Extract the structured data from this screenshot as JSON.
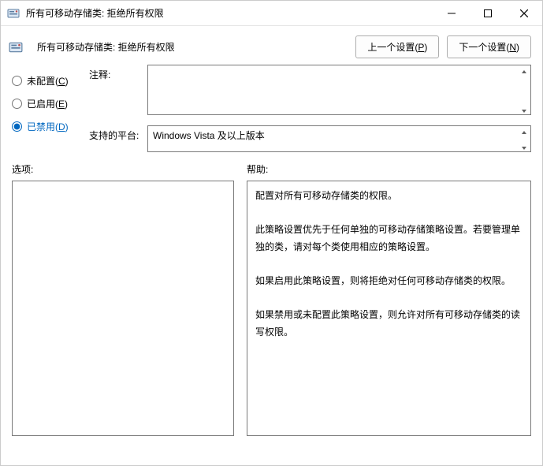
{
  "titlebar": {
    "title": "所有可移动存储类: 拒绝所有权限"
  },
  "header": {
    "policy_title": "所有可移动存储类: 拒绝所有权限",
    "prev_button_pre": "上一个设置(",
    "prev_button_accel": "P",
    "prev_button_post": ")",
    "next_button_pre": "下一个设置(",
    "next_button_accel": "N",
    "next_button_post": ")"
  },
  "radios": {
    "not_configured_pre": "未配置(",
    "not_configured_accel": "C",
    "not_configured_post": ")",
    "enabled_pre": "已启用(",
    "enabled_accel": "E",
    "enabled_post": ")",
    "disabled_pre": "已禁用(",
    "disabled_accel": "D",
    "disabled_post": ")",
    "selected": "disabled"
  },
  "fields": {
    "comment_label": "注释:",
    "comment_value": "",
    "platform_label": "支持的平台:",
    "platform_value": "Windows Vista 及以上版本"
  },
  "lower": {
    "options_label": "选项:",
    "help_label": "帮助:",
    "help_text_p1": "配置对所有可移动存储类的权限。",
    "help_text_p2": "此策略设置优先于任何单独的可移动存储策略设置。若要管理单独的类，请对每个类使用相应的策略设置。",
    "help_text_p3": "如果启用此策略设置，则将拒绝对任何可移动存储类的权限。",
    "help_text_p4": "如果禁用或未配置此策略设置，则允许对所有可移动存储类的读写权限。"
  }
}
